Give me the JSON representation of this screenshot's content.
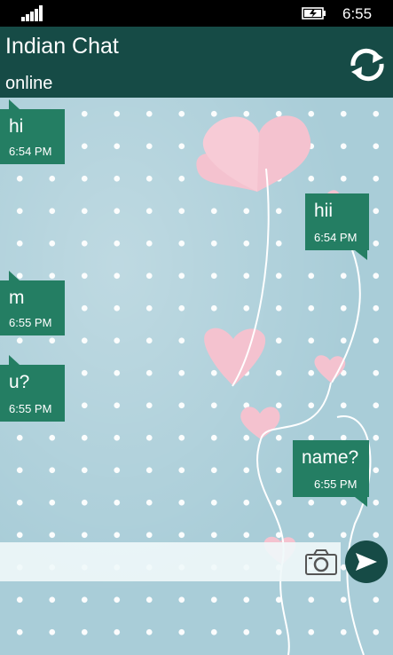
{
  "status_bar": {
    "time": "6:55",
    "signal_icon": "signal-icon",
    "battery_icon": "battery-charging-icon"
  },
  "header": {
    "title": "Indian Chat",
    "status": "online",
    "refresh_icon": "refresh-icon"
  },
  "messages": [
    {
      "direction": "incoming",
      "text": "hi",
      "time": "6:54 PM"
    },
    {
      "direction": "outgoing",
      "text": "hii",
      "time": "6:54 PM"
    },
    {
      "direction": "incoming",
      "text": "m",
      "time": "6:55 PM"
    },
    {
      "direction": "incoming",
      "text": "u?",
      "time": "6:55 PM"
    },
    {
      "direction": "outgoing",
      "text": "name?",
      "time": "6:55 PM"
    }
  ],
  "composer": {
    "value": "",
    "placeholder": "",
    "camera_icon": "camera-icon",
    "send_icon": "send-icon"
  },
  "colors": {
    "header": "#164b46",
    "bubble": "#247e63",
    "background": "#a9cdd8",
    "heart": "#f4c2cf"
  }
}
